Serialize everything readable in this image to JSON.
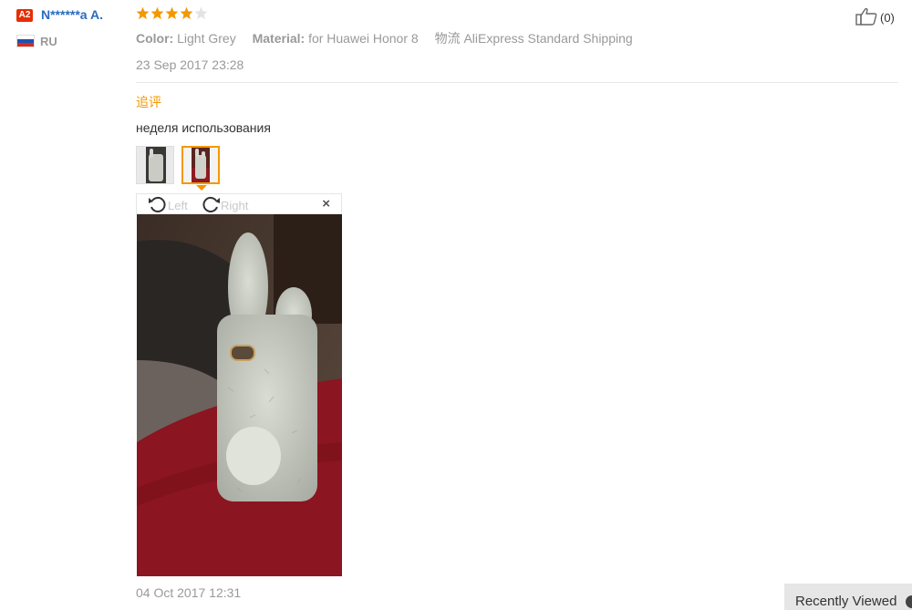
{
  "user": {
    "level": "A2",
    "name": "N******a A.",
    "country": "RU",
    "flag_colors": [
      "#ffffff",
      "#1f4fb4",
      "#d52b1e"
    ]
  },
  "review": {
    "rating": 4,
    "max_rating": 5,
    "star_color": "#f39800",
    "attributes": {
      "color_key": "Color:",
      "color_value": "Light Grey",
      "material_key": "Material:",
      "material_value": "for Huawei Honor 8",
      "shipping_key": "物流",
      "shipping_value": "AliExpress Standard Shipping"
    },
    "date": "23 Sep 2017 23:28",
    "likes": "(0)"
  },
  "followup": {
    "label": "追评",
    "text": "неделя использования",
    "date": "04 Oct 2017 12:31",
    "thumbnails": [
      "thumbnail-photo-1",
      "thumbnail-photo-2"
    ],
    "viewer": {
      "rotate_left": "Left",
      "rotate_right": "Right",
      "close": "×"
    }
  },
  "recently_viewed": {
    "label": "Recently Viewed"
  },
  "colors": {
    "accent": "#f39800",
    "link": "#2a6bc0",
    "muted": "#999999"
  }
}
